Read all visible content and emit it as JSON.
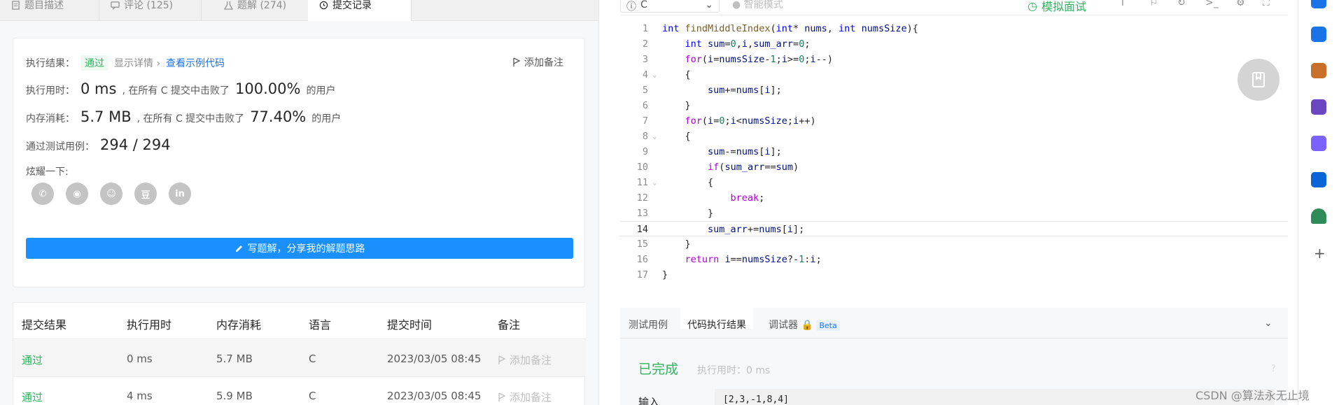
{
  "tabs": [
    {
      "label": "题目描述"
    },
    {
      "label": "评论 (125)"
    },
    {
      "label": "题解 (274)"
    },
    {
      "label": "提交记录"
    }
  ],
  "result": {
    "label_result": "执行结果：",
    "status": "通过",
    "detail": "显示详情 ›",
    "sample": "查看示例代码",
    "add_note": "添加备注",
    "label_time": "执行用时：",
    "time_value": "0 ms",
    "time_mid": ", 在所有 C 提交中击败了",
    "time_pct": "100.00%",
    "users": "的用户",
    "label_mem": "内存消耗：",
    "mem_value": "5.7 MB",
    "mem_mid": ", 在所有 C 提交中击败了",
    "mem_pct": "77.40%",
    "label_tests": "通过测试用例：",
    "tests_value": "294 / 294",
    "label_share": "炫耀一下:",
    "share_items": [
      "wechat-icon",
      "weibo-icon",
      "qq-icon",
      "douban-icon",
      "linkedin-icon"
    ],
    "write_button": "写题解，分享我的解题思路"
  },
  "table": {
    "headers": [
      "提交结果",
      "执行用时",
      "内存消耗",
      "语言",
      "提交时间",
      "备注"
    ],
    "rows": [
      {
        "result": "通过",
        "time": "0 ms",
        "mem": "5.7 MB",
        "lang": "C",
        "date": "2023/03/05 08:45",
        "note": "添加备注"
      },
      {
        "result": "通过",
        "time": "4 ms",
        "mem": "5.9 MB",
        "lang": "C",
        "date": "2023/03/05 08:45",
        "note": "添加备注"
      }
    ]
  },
  "editor": {
    "language": "C",
    "smart_mode": "智能模式",
    "mock_interview": "模拟面试",
    "current_line": 14
  },
  "bottom": {
    "tabs": [
      "测试用例",
      "代码执行结果",
      "调试器"
    ],
    "beta": "Beta",
    "done": "已完成",
    "exec_time": "执行用时：0 ms",
    "input_label": "输入",
    "input_value": "[2,3,-1,8,4]"
  },
  "watermark": "CSDN @算法永无止境",
  "colors": {
    "accent": "#1a90ff",
    "success": "#2db55d",
    "link": "#1a73e8"
  }
}
